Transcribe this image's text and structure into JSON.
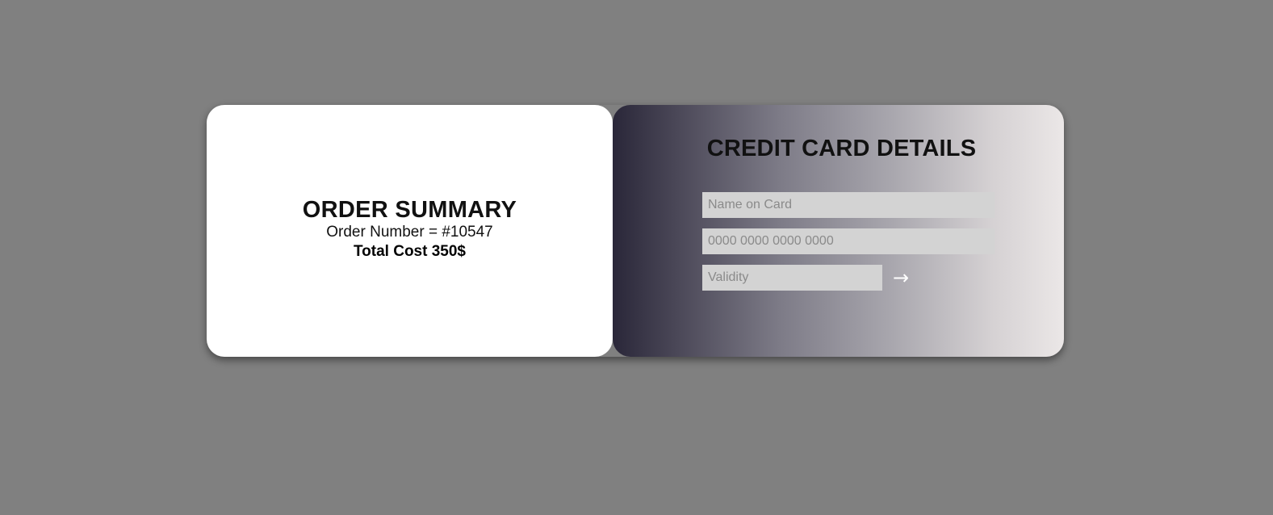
{
  "summary": {
    "title": "ORDER SUMMARY",
    "order_number": "Order Number = #10547",
    "total_cost": "Total Cost 350$"
  },
  "card": {
    "title": "CREDIT CARD DETAILS",
    "name_placeholder": "Name on Card",
    "number_placeholder": "0000 0000 0000 0000",
    "validity_placeholder": "Validity",
    "submit_icon": "→"
  },
  "colors": {
    "background": "#808080",
    "summary_bg": "#ffffff",
    "gradient_start": "#2a2739",
    "gradient_end": "#ebe7e7",
    "field_bg": "#d3d3d3"
  }
}
